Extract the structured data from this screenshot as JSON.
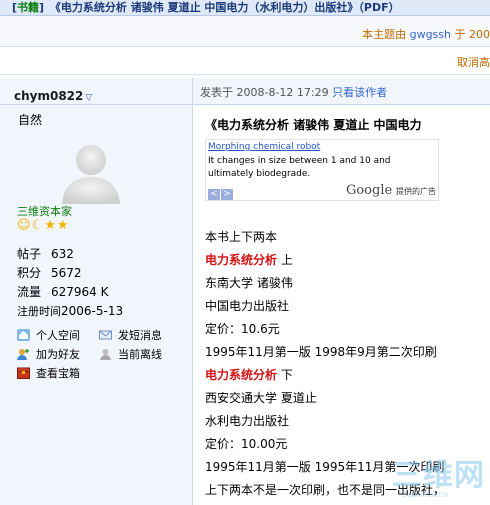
{
  "header": {
    "tag": "书籍",
    "title": "《电力系统分析 诸骏伟 夏道止 中国电力（水利电力）出版社》（PDF）"
  },
  "topic_bar": {
    "prefix": "本主题由",
    "user": "gwgssh",
    "suffix": "于 200"
  },
  "bar2": {
    "cancel": "取消高"
  },
  "author": {
    "name": "chym0822",
    "custom_title": "自然",
    "rank": "三维资本家",
    "stats": [
      {
        "k": "帖子",
        "v": "632"
      },
      {
        "k": "积分",
        "v": "5672"
      },
      {
        "k": "流量",
        "v": "627964 K"
      },
      {
        "k": "注册时间",
        "v": "2006-5-13"
      }
    ],
    "actions": {
      "home": "个人空间",
      "pm": "发短消息",
      "friend": "加为好友",
      "status": "当前离线",
      "treasure": "查看宝箱"
    }
  },
  "post": {
    "meta_prefix": "发表于",
    "meta_time": "2008-8-12 17:29",
    "only_author": "只看该作者",
    "title": "《电力系统分析 诸骏伟 夏道止 中国电力",
    "ad": {
      "link": "Morphing chemical robot",
      "text": "It changes in size between 1 and 10 and ultimately biodegrade.",
      "google": "Google",
      "google_sub": "提供的广告"
    },
    "lines": [
      {
        "text": "本书上下两本"
      },
      {
        "bold": "电力系统分析",
        "text": " 上"
      },
      {
        "text": "东南大学 诸骏伟"
      },
      {
        "text": "中国电力出版社"
      },
      {
        "text": "定价：10.6元"
      },
      {
        "text": "1995年11月第一版  1998年9月第二次印刷"
      },
      {
        "bold": "电力系统分析",
        "text": " 下"
      },
      {
        "text": "西安交通大学 夏道止"
      },
      {
        "text": "水利电力出版社"
      },
      {
        "text": "定价：10.00元"
      },
      {
        "text": "1995年11月第一版  1995年11月第一次印刷"
      },
      {
        "text": "上下两本不是一次印刷，也不是同一出版社，"
      }
    ]
  },
  "watermark": {
    "big": "三维网",
    "small": "3dportal.cn"
  }
}
